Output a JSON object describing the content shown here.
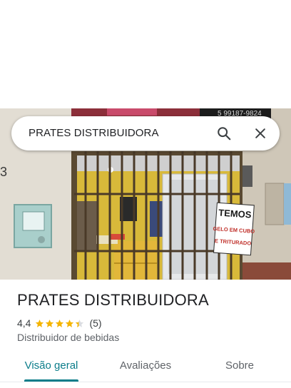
{
  "search": {
    "query": "PRATES DISTRIBUIDORA",
    "search_icon": "search-icon",
    "close_icon": "close-icon"
  },
  "photo": {
    "sign_line1": "TEMOS",
    "sign_line2": "GELO EM CUBO",
    "sign_line3": "E TRITURADO",
    "banner_text": "5 99187-9824",
    "house_number": "3"
  },
  "place": {
    "name": "PRATES DISTRIBUIDORA",
    "rating": "4,4",
    "stars": 4.4,
    "review_count": "(5)",
    "category": "Distribuidor de bebidas"
  },
  "tabs": [
    {
      "label": "Visão geral",
      "active": true
    },
    {
      "label": "Avaliações",
      "active": false
    },
    {
      "label": "Sobre",
      "active": false
    }
  ],
  "colors": {
    "accent": "#0b7d8a",
    "star": "#f4b400"
  }
}
